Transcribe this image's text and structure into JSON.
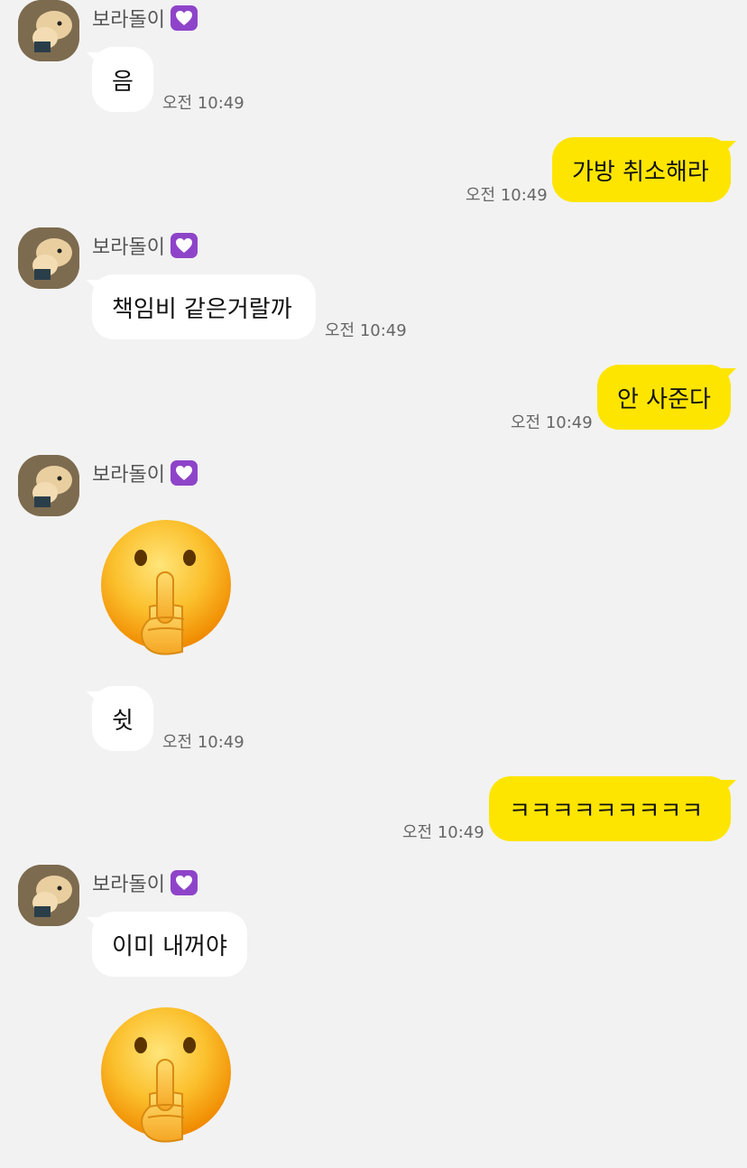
{
  "contact": {
    "name": "보라돌이",
    "badge_icon": "purple-heart-icon",
    "badge_color": "#8e44c9"
  },
  "colors": {
    "background": "#f2f2f2",
    "incoming": "#ffffff",
    "outgoing": "#fee500"
  },
  "messages": [
    {
      "dir": "in",
      "text": "음",
      "time": "오전 10:49"
    },
    {
      "dir": "out",
      "text": "가방 취소해라",
      "time": "오전 10:49"
    },
    {
      "dir": "in",
      "text": "책임비 같은거랄까",
      "time": "오전 10:49"
    },
    {
      "dir": "out",
      "text": "안 사준다",
      "time": "오전 10:49"
    },
    {
      "dir": "in",
      "emoji": "shushing-face-emoji"
    },
    {
      "dir": "in",
      "text": "쉿",
      "time": "오전 10:49"
    },
    {
      "dir": "out",
      "text": "ㅋㅋㅋㅋㅋㅋㅋㅋㅋ",
      "time": "오전 10:49"
    },
    {
      "dir": "in",
      "text": "이미 내꺼야"
    },
    {
      "dir": "in",
      "emoji": "shushing-face-emoji"
    }
  ]
}
